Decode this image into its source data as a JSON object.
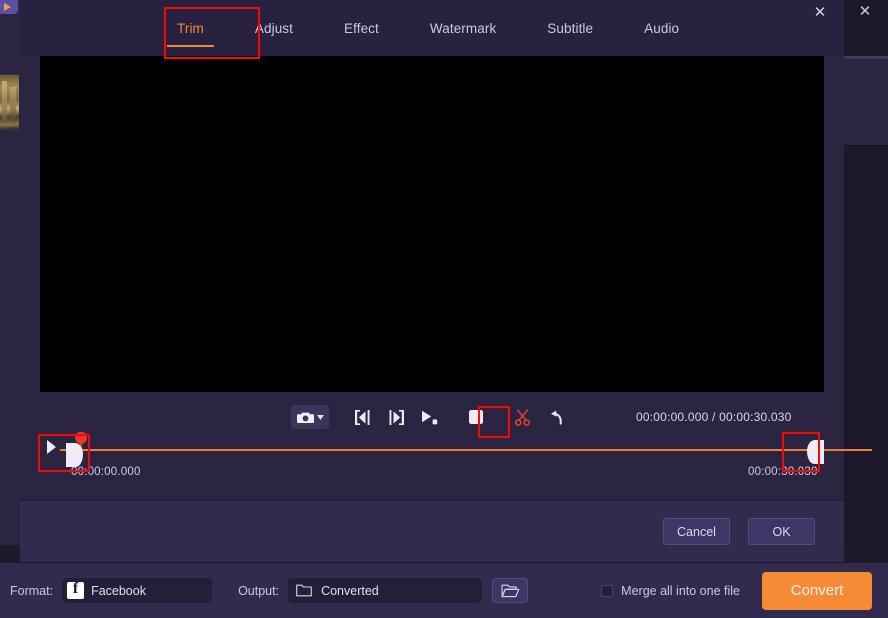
{
  "app": {
    "close_icon": "close-icon",
    "bottom_bar": {
      "format_label": "Format:",
      "format_value": "Facebook",
      "format_icon": "facebook-icon",
      "output_label": "Output:",
      "output_value": "Converted",
      "output_icon": "folder-icon",
      "browse_icon": "folder-open-icon",
      "merge_label": "Merge all into one file",
      "merge_checked": false,
      "convert_label": "Convert",
      "convert_color": "#f68a35"
    }
  },
  "dialog": {
    "close_icon": "close-icon",
    "tabs": [
      {
        "label": "Trim",
        "active": true
      },
      {
        "label": "Adjust",
        "active": false
      },
      {
        "label": "Effect",
        "active": false
      },
      {
        "label": "Watermark",
        "active": false
      },
      {
        "label": "Subtitle",
        "active": false
      },
      {
        "label": "Audio",
        "active": false
      }
    ],
    "active_tab_color": "#f2873a",
    "preview": {
      "background": "#000000"
    },
    "controls": [
      {
        "name": "snapshot-button",
        "icon": "camera-icon",
        "has_dropdown": true
      },
      {
        "name": "previous-frame-button",
        "icon": "previous-frame-icon"
      },
      {
        "name": "next-frame-button",
        "icon": "next-frame-icon"
      },
      {
        "name": "play-segment-button",
        "icon": "play-segment-icon"
      },
      {
        "name": "stop-button",
        "icon": "stop-icon"
      },
      {
        "name": "cut-button",
        "icon": "scissors-icon",
        "highlighted": true
      },
      {
        "name": "undo-button",
        "icon": "undo-icon"
      }
    ],
    "time_readout": "00:00:00.000 / 00:00:30.030",
    "timeline": {
      "current_time": "00:00:00.000",
      "start_label": "00:00:00.000",
      "end_label": "00:00:30.030",
      "track_color": "#f07f33",
      "playhead_color": "#e9392a",
      "handle_color": "#efecf6"
    },
    "footer": {
      "cancel_label": "Cancel",
      "ok_label": "OK"
    }
  },
  "annotations": {
    "highlight_color": "#fb0606",
    "boxes": [
      "trim-tab",
      "cut-button",
      "left-trim-handle",
      "right-trim-handle"
    ]
  }
}
